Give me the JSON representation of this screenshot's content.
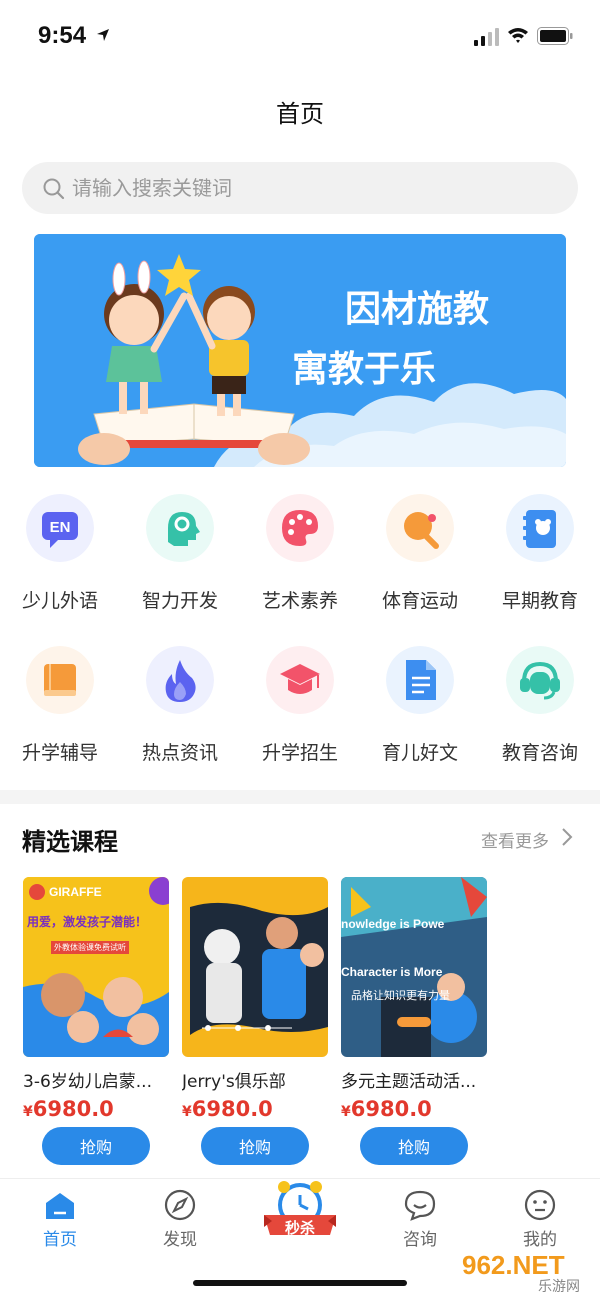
{
  "status_bar": {
    "time": "9:54"
  },
  "header": {
    "title": "首页"
  },
  "search": {
    "placeholder": "请输入搜索关键词"
  },
  "banner": {
    "line1": "因材施教",
    "line2": "寓教于乐"
  },
  "categories": [
    {
      "label": "少儿外语",
      "icon": "en-language-icon",
      "color": "#5b63f0",
      "text": "EN"
    },
    {
      "label": "智力开发",
      "icon": "brain-gear-icon",
      "color": "#35c1a8"
    },
    {
      "label": "艺术素养",
      "icon": "palette-icon",
      "color": "#f2536a"
    },
    {
      "label": "体育运动",
      "icon": "ping-pong-icon",
      "color": "#f59a3a"
    },
    {
      "label": "早期教育",
      "icon": "baby-book-icon",
      "color": "#3d8ef0"
    },
    {
      "label": "升学辅导",
      "icon": "book-icon",
      "color": "#f59a3a"
    },
    {
      "label": "热点资讯",
      "icon": "flame-icon",
      "color": "#5b63f0"
    },
    {
      "label": "升学招生",
      "icon": "graduation-cap-icon",
      "color": "#f2536a"
    },
    {
      "label": "育儿好文",
      "icon": "document-icon",
      "color": "#3d8ef0"
    },
    {
      "label": "教育咨询",
      "icon": "headset-icon",
      "color": "#35c1a8"
    }
  ],
  "featured": {
    "title": "精选课程",
    "more": "查看更多",
    "courses": [
      {
        "name": "3-6岁幼儿启蒙...",
        "currency": "¥",
        "price": "6980.0",
        "buy": "抢购",
        "thumb_brand": "GIRAFFE",
        "thumb_slogan": "用爱，激发孩子潜能！",
        "thumb_sub": "外教体验课免费试听"
      },
      {
        "name": "Jerry's俱乐部",
        "currency": "¥",
        "price": "6980.0",
        "buy": "抢购"
      },
      {
        "name": "多元主题活动活...",
        "currency": "¥",
        "price": "6980.0",
        "buy": "抢购",
        "thumb_line1": "nowledge is Powe",
        "thumb_line2": "Character is More",
        "thumb_sub": "品格让知识更有力量"
      }
    ]
  },
  "tab_bar": {
    "tabs": [
      {
        "label": "首页",
        "active": true
      },
      {
        "label": "发现",
        "active": false
      },
      {
        "label": "秒杀",
        "active": false
      },
      {
        "label": "咨询",
        "active": false
      },
      {
        "label": "我的",
        "active": false
      }
    ]
  },
  "watermark": {
    "text": "962.NET",
    "sub": "乐游网"
  },
  "colors": {
    "accent": "#2a8ae8",
    "price": "#e2382c",
    "banner": "#3a9cf2"
  }
}
